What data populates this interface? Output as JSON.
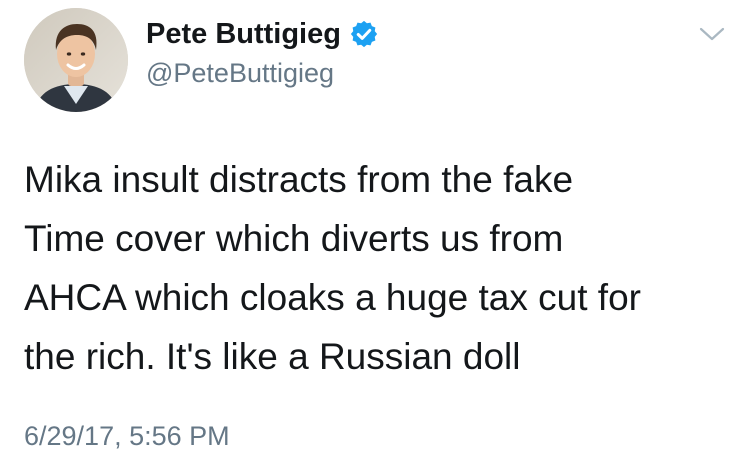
{
  "author": {
    "display_name": "Pete Buttigieg",
    "handle": "@PeteButtigieg",
    "verified": true,
    "avatar_icon": "profile-photo"
  },
  "tweet": {
    "text_lines": [
      "Mika insult distracts from the fake",
      "Time cover which diverts us from",
      "AHCA which cloaks a huge tax cut for",
      "the rich. It's like a Russian doll"
    ],
    "timestamp": "6/29/17, 5:56 PM"
  },
  "icons": {
    "verified": "verified-badge-icon",
    "menu": "chevron-down-icon"
  },
  "colors": {
    "text": "#14171a",
    "secondary": "#657786",
    "verified_blue": "#1da1f2",
    "caret": "#aab8c2"
  }
}
